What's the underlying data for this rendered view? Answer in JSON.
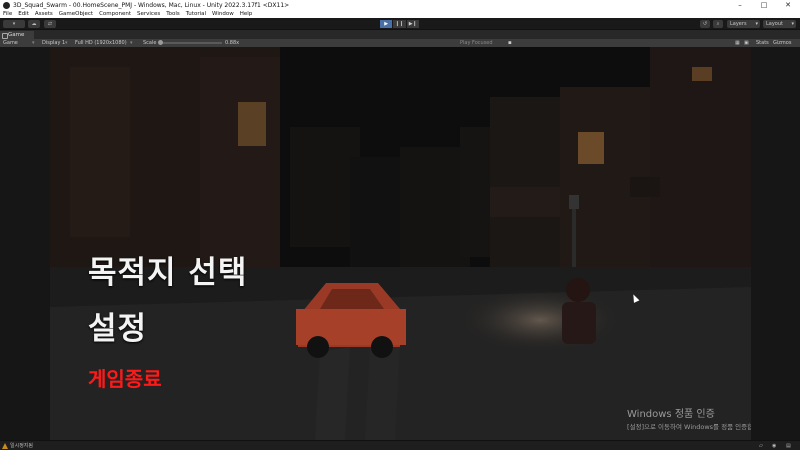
{
  "window": {
    "title": "3D_Squad_Swarm - 00.HomeScene_PMJ - Windows, Mac, Linux - Unity 2022.3.17f1 <DX11>",
    "minimize": "–",
    "maximize": "□",
    "close": "✕"
  },
  "menu": [
    "File",
    "Edit",
    "Assets",
    "GameObject",
    "Component",
    "Services",
    "Tools",
    "Tutorial",
    "Window",
    "Help"
  ],
  "toolbar": {
    "account": "▾",
    "cloud": "☁",
    "collab": "⇄",
    "play": "▶",
    "pause": "❙❙",
    "step": "▶❙",
    "history": "↺",
    "search": "⌕",
    "layers": "Layers",
    "layout": "Layout"
  },
  "tab": {
    "label": "Game"
  },
  "gamebar": {
    "mode": "Game",
    "display": "Display 1",
    "resolution": "Full HD (1920x1080)",
    "scale_label": "Scale",
    "scale_value": "0.88x",
    "play_focused": "Play Focused",
    "stats": "Stats",
    "gizmos": "Gizmos"
  },
  "game": {
    "menu_items": [
      "목적지 선택",
      "설정"
    ],
    "quit": "게임종료"
  },
  "watermark": {
    "line1": "Windows 정품 인증",
    "line2": "[설정]으로 이동하여 Windows를 정품 인증합니다."
  },
  "status": {
    "message": "일시정지됨"
  },
  "colors": {
    "accent": "#4a6fa5",
    "quit": "#ff1a1a",
    "editor_bg": "#191919"
  }
}
